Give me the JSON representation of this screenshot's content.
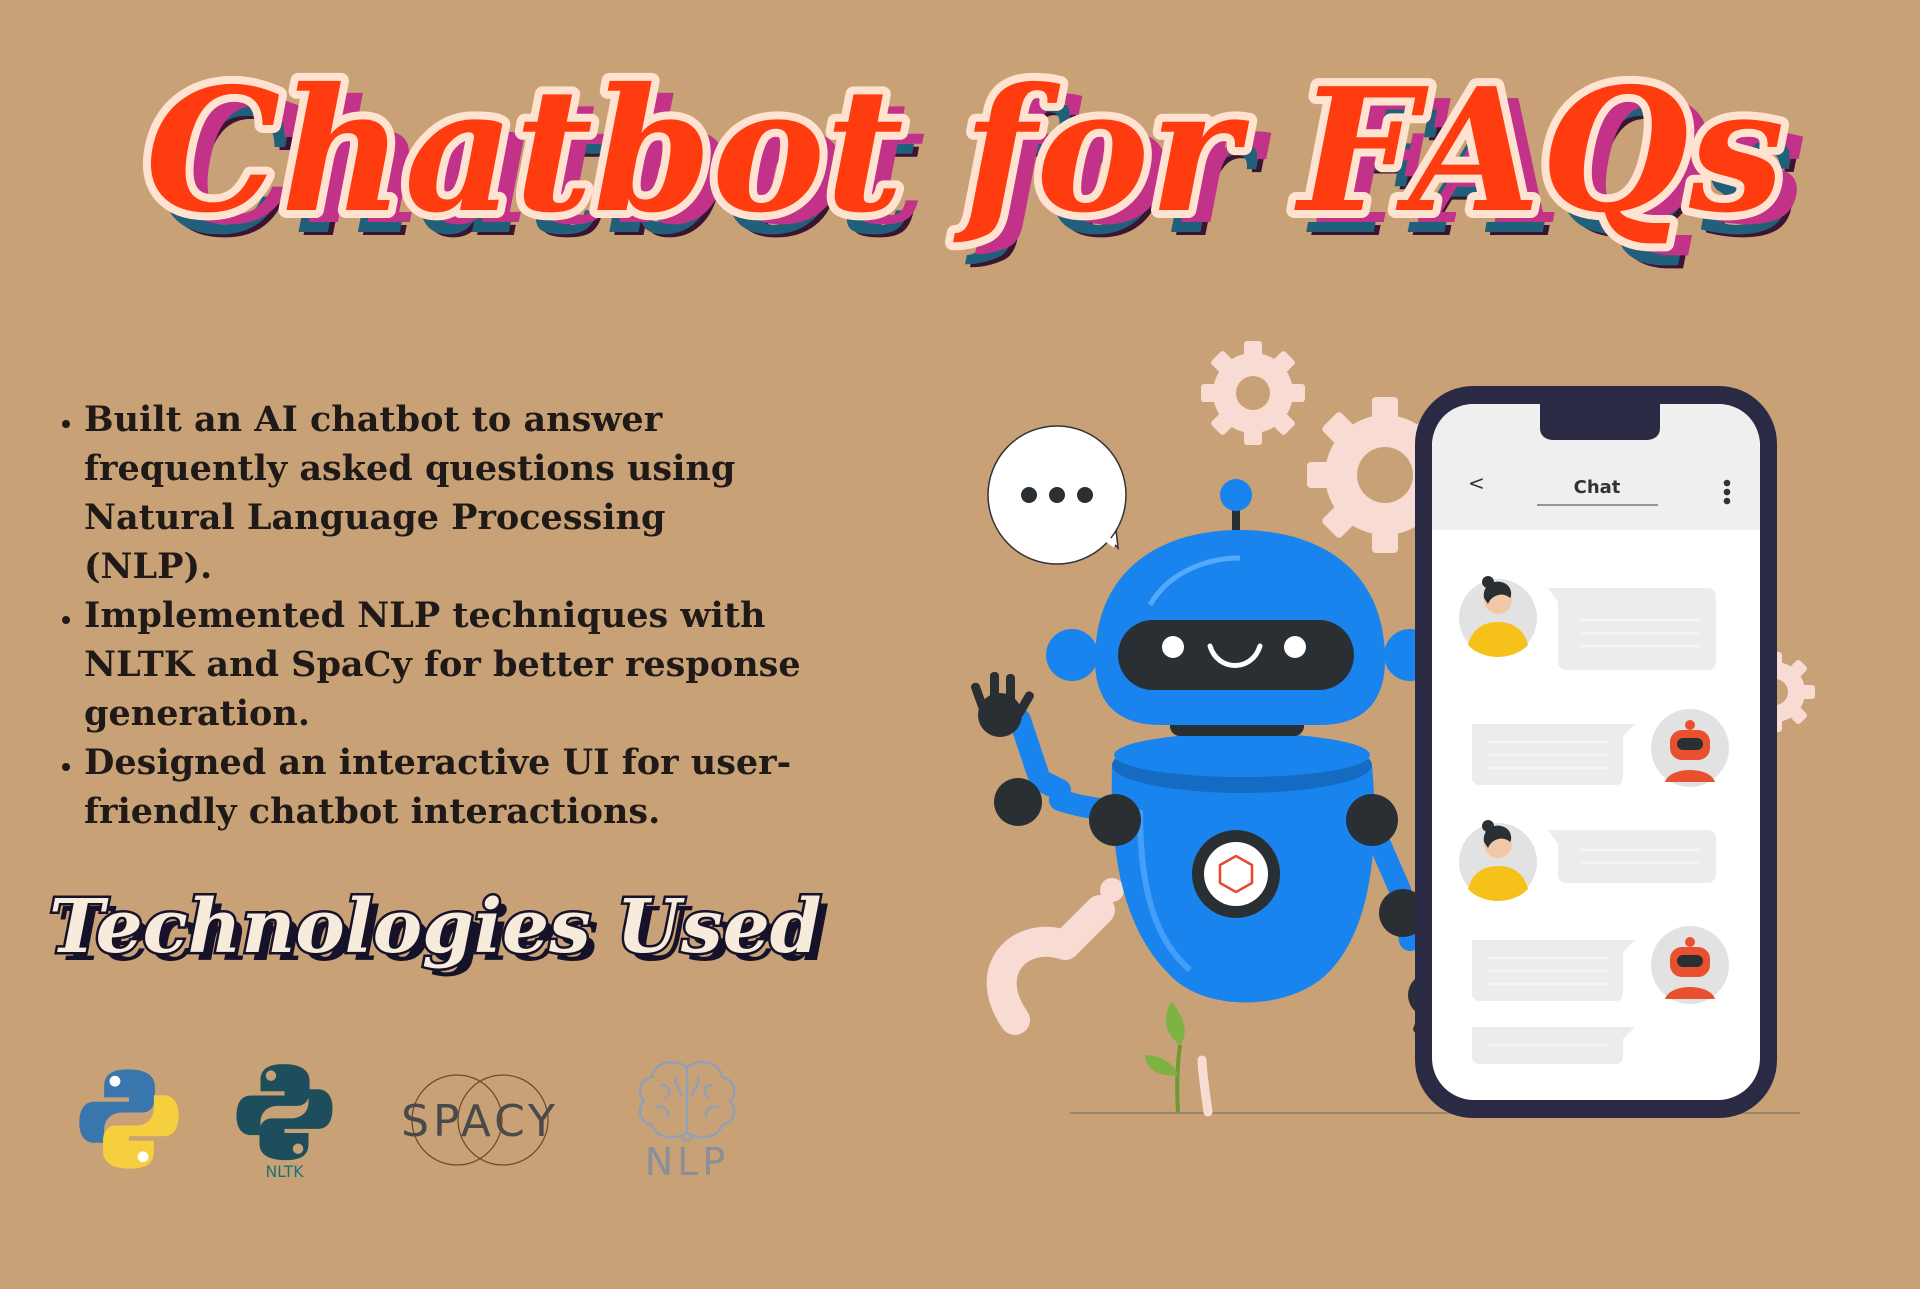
{
  "title": "Chatbot for FAQs",
  "bullets": [
    "Built an AI chatbot to answer frequently asked questions using Natural Language Processing (NLP).",
    "Implemented NLP techniques with NLTK and SpaCy for better response generation.",
    "Designed an interactive UI for user-friendly chatbot interactions."
  ],
  "tech_heading": "Technologies Used",
  "logos": {
    "python": "python-icon",
    "nltk": {
      "icon": "nltk-icon",
      "label": "NLTK"
    },
    "spacy": {
      "icon": "spacy-logo",
      "label": "SPACY"
    },
    "nlp": {
      "icon": "brain-icon",
      "label": "NLP"
    }
  },
  "phone": {
    "back": "<",
    "title": "Chat"
  },
  "colors": {
    "background": "#C9A176",
    "title_fill": "#FF3C10",
    "title_outline": "#FFE3D0",
    "title_shadow": "#C23289",
    "robot": "#1A84EE",
    "phone_frame": "#2A2A45"
  }
}
